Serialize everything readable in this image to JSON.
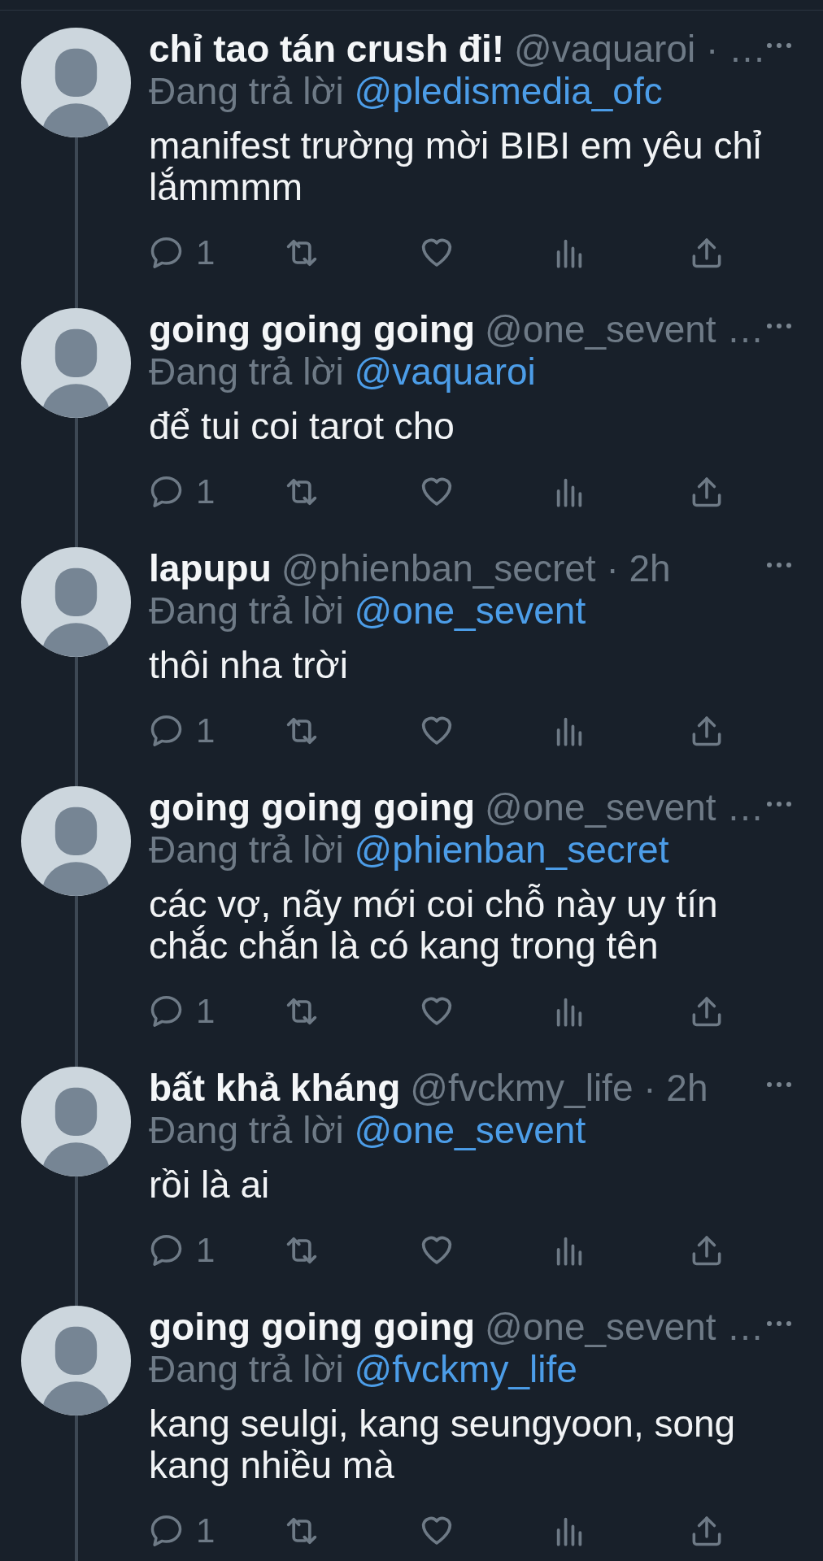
{
  "tweets": [
    {
      "name": "chỉ tao tán crush đi!",
      "meta": "@vaquaroi · …",
      "reply_prefix": "Đang trả lời",
      "reply_to": "@pledismedia_ofc",
      "body": "manifest trường mời BIBI em yêu chỉ\nlắmmmm",
      "reply_count": "1"
    },
    {
      "name": "going going going",
      "meta": "@one_sevent …",
      "reply_prefix": "Đang trả lời",
      "reply_to": "@vaquaroi",
      "body": "để tui coi tarot cho",
      "reply_count": "1"
    },
    {
      "name": "lapupu",
      "meta": "@phienban_secret · 2h",
      "reply_prefix": "Đang trả lời",
      "reply_to": "@one_sevent",
      "body": "thôi nha trời",
      "reply_count": "1"
    },
    {
      "name": "going going going",
      "meta": "@one_sevent …",
      "reply_prefix": "Đang trả lời",
      "reply_to": "@phienban_secret",
      "body": "các vợ, nãy mới coi chỗ này uy tín\nchắc chắn là có kang trong tên",
      "reply_count": "1"
    },
    {
      "name": "bất khả kháng",
      "meta": "@fvckmy_life · 2h",
      "reply_prefix": "Đang trả lời",
      "reply_to": "@one_sevent",
      "body": "rồi là ai",
      "reply_count": "1"
    },
    {
      "name": "going going going",
      "meta": "@one_sevent …",
      "reply_prefix": "Đang trả lời",
      "reply_to": "@fvckmy_life",
      "body": "kang seulgi, kang seungyoon, song\nkang nhiều mà",
      "reply_count": "1"
    }
  ]
}
